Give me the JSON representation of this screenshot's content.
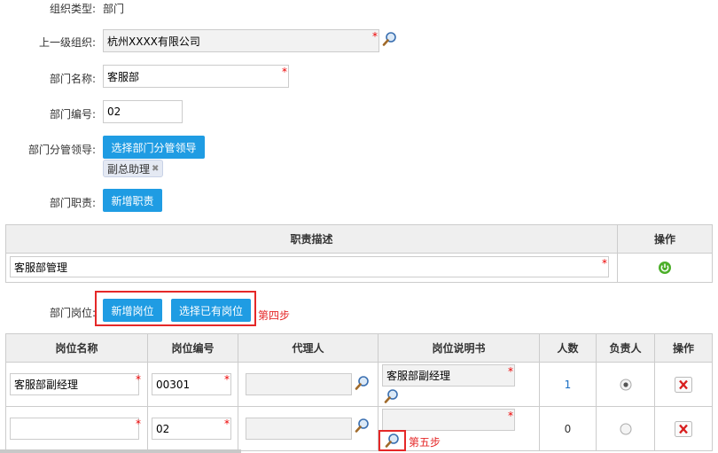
{
  "form": {
    "org_type_label": "组织类型:",
    "org_type_value": "部门",
    "parent_org_label": "上一级组织:",
    "parent_org_value": "杭州XXXX有限公司",
    "dept_name_label": "部门名称:",
    "dept_name_value": "客服部",
    "dept_code_label": "部门编号:",
    "dept_code_value": "02",
    "leader_label": "部门分管领导:",
    "leader_button": "选择部门分管领导",
    "leader_tag": "副总助理",
    "duty_label": "部门职责:",
    "duty_button": "新增职责",
    "required_mark": "*"
  },
  "duty_table": {
    "headers": [
      "职责描述",
      "操作"
    ],
    "rows": [
      {
        "description": "客服部管理"
      }
    ]
  },
  "positions": {
    "label": "部门岗位:",
    "add_button": "新增岗位",
    "select_button": "选择已有岗位",
    "step4_note": "第四步",
    "step5_note": "第五步",
    "headers": [
      "岗位名称",
      "岗位编号",
      "代理人",
      "岗位说明书",
      "人数",
      "负责人",
      "操作"
    ],
    "rows": [
      {
        "name": "客服部副经理",
        "code": "00301",
        "agent": "",
        "spec": "客服部副经理",
        "count": "1",
        "leader": true
      },
      {
        "name": "",
        "code": "02",
        "agent": "",
        "spec": "",
        "count": "0",
        "leader": false
      }
    ]
  },
  "colors": {
    "primary": "#1f9ce3",
    "highlight": "#e52828",
    "required": "#e00000"
  }
}
